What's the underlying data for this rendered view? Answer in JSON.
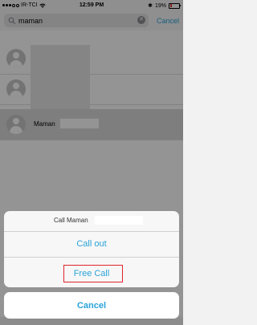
{
  "status_bar": {
    "carrier": "IR-TCI",
    "time": "12:59 PM",
    "battery": "19%"
  },
  "search": {
    "value": "maman",
    "cancel_label": "Cancel"
  },
  "contacts": [
    {
      "name": ""
    },
    {
      "name": ""
    },
    {
      "name": "Maman"
    }
  ],
  "action_sheet": {
    "title": "Call Maman",
    "call_out_label": "Call out",
    "free_call_label": "Free Call",
    "cancel_label": "Cancel"
  },
  "colors": {
    "accent": "#2aa3d8",
    "highlight_border": "#e0242c"
  }
}
